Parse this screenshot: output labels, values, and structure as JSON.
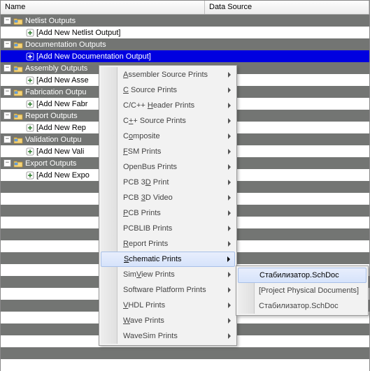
{
  "header": {
    "name": "Name",
    "source": "Data Source"
  },
  "groups": [
    {
      "label": "Netlist Outputs",
      "add": "[Add New Netlist Output]",
      "selected": false
    },
    {
      "label": "Documentation Outputs",
      "add": "[Add New Documentation Output]",
      "selected": true
    },
    {
      "label": "Assembly Outputs",
      "add": "[Add New Asse",
      "selected": false
    },
    {
      "label": "Fabrication Outpu",
      "add": "[Add New Fabr",
      "selected": false
    },
    {
      "label": "Report Outputs",
      "add": "[Add New Rep",
      "selected": false
    },
    {
      "label": "Validation Outpu",
      "add": "[Add New Vali",
      "selected": false
    },
    {
      "label": "Export Outputs",
      "add": "[Add New Expo",
      "selected": false
    }
  ],
  "menu": {
    "items": [
      {
        "label": "Assembler Source Prints",
        "u": 0,
        "arrow": true
      },
      {
        "label": "C Source Prints",
        "u": 0,
        "arrow": true
      },
      {
        "label": "C/C++ Header Prints",
        "u": 6,
        "arrow": true
      },
      {
        "label": "C++ Source Prints",
        "u": 1,
        "arrow": true
      },
      {
        "label": "Composite",
        "u": 1,
        "arrow": true
      },
      {
        "label": "FSM Prints",
        "u": 0,
        "arrow": true
      },
      {
        "label": "OpenBus Prints",
        "u": -1,
        "arrow": true
      },
      {
        "label": "PCB 3D Print",
        "u": 5,
        "arrow": true
      },
      {
        "label": "PCB 3D Video",
        "u": 4,
        "arrow": true
      },
      {
        "label": "PCB Prints",
        "u": 0,
        "arrow": true
      },
      {
        "label": "PCBLIB Prints",
        "u": -1,
        "arrow": true
      },
      {
        "label": "Report Prints",
        "u": 0,
        "arrow": true
      },
      {
        "label": "Schematic Prints",
        "u": 0,
        "arrow": true,
        "highlighted": true
      },
      {
        "label": "SimView Prints",
        "u": 3,
        "arrow": true
      },
      {
        "label": "Software Platform Prints",
        "u": -1,
        "arrow": true
      },
      {
        "label": "VHDL Prints",
        "u": 0,
        "arrow": true
      },
      {
        "label": "Wave Prints",
        "u": 0,
        "arrow": true
      },
      {
        "label": "WaveSim Prints",
        "u": -1,
        "arrow": true
      }
    ]
  },
  "submenu": {
    "items": [
      {
        "label": "Стабилизатор.SchDoc",
        "highlighted": true
      },
      {
        "label": "[Project Physical Documents]"
      },
      {
        "label": "Стабилизатор.SchDoc"
      }
    ]
  }
}
